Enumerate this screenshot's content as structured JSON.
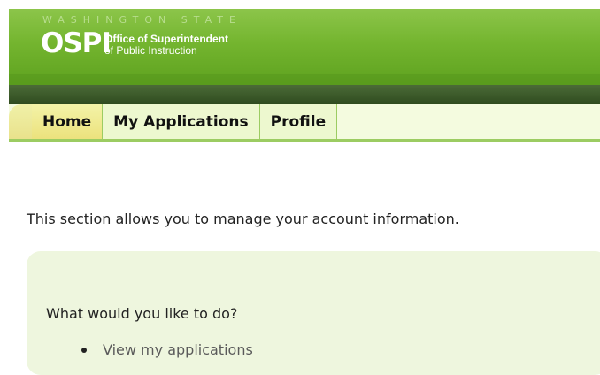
{
  "header": {
    "wa_state_text": "WASHINGTON STATE",
    "ospi_acronym": "OSPI",
    "ospi_line1": "Office of Superintendent",
    "ospi_line2": "of Public Instruction"
  },
  "tabs": [
    {
      "label": "Home",
      "active": true
    },
    {
      "label": "My Applications",
      "active": false
    },
    {
      "label": "Profile",
      "active": false
    }
  ],
  "content": {
    "description": "This section allows you to manage your account information.",
    "panel": {
      "question": "What would you like to do?",
      "links": [
        {
          "label": "View my applications"
        }
      ]
    }
  }
}
